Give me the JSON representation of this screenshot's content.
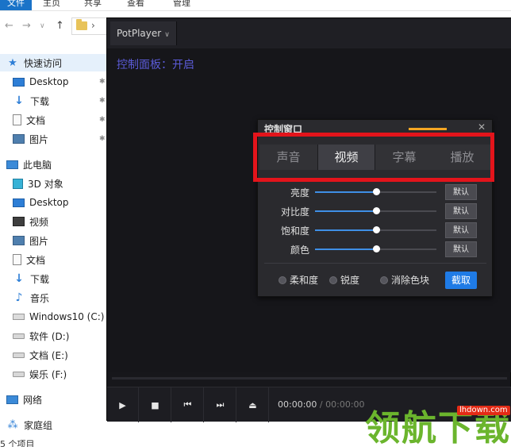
{
  "ribbon": {
    "file_tab": "文件",
    "tabs": [
      "主页",
      "共享",
      "查看",
      "管理"
    ]
  },
  "navpane": {
    "items": [
      {
        "label": "快速访问",
        "icon": "star-icon"
      },
      {
        "label": "Desktop",
        "icon": "desktop-icon"
      },
      {
        "label": "下载",
        "icon": "download-arrow-icon"
      },
      {
        "label": "文档",
        "icon": "document-icon"
      },
      {
        "label": "图片",
        "icon": "pictures-icon"
      },
      {
        "label": "此电脑",
        "icon": "computer-icon"
      },
      {
        "label": "3D 对象",
        "icon": "3d-objects-icon"
      },
      {
        "label": "Desktop",
        "icon": "desktop-icon"
      },
      {
        "label": "视频",
        "icon": "video-icon"
      },
      {
        "label": "图片",
        "icon": "pictures-icon"
      },
      {
        "label": "文档",
        "icon": "document-icon"
      },
      {
        "label": "下载",
        "icon": "download-arrow-icon"
      },
      {
        "label": "音乐",
        "icon": "music-icon"
      },
      {
        "label": "Windows10 (C:)",
        "icon": "system-drive-icon"
      },
      {
        "label": "软件 (D:)",
        "icon": "drive-icon"
      },
      {
        "label": "文档 (E:)",
        "icon": "drive-icon"
      },
      {
        "label": "娱乐 (F:)",
        "icon": "drive-icon"
      },
      {
        "label": "网络",
        "icon": "network-icon"
      },
      {
        "label": "家庭组",
        "icon": "homegroup-icon"
      }
    ],
    "status": "5 个项目"
  },
  "player": {
    "title": "PotPlayer",
    "osd_text": "控制面板：开启",
    "time_current": "00:00:00",
    "time_separator": "/",
    "time_total": "00:00:00"
  },
  "panel": {
    "title": "控制窗口",
    "tabs": [
      "声音",
      "视频",
      "字幕",
      "播放"
    ],
    "active_tab": "视频",
    "sliders": [
      {
        "label": "亮度",
        "value": 0.5,
        "button": "默认"
      },
      {
        "label": "对比度",
        "value": 0.5,
        "button": "默认"
      },
      {
        "label": "饱和度",
        "value": 0.5,
        "button": "默认"
      },
      {
        "label": "颜色",
        "value": 0.5,
        "button": "默认"
      }
    ],
    "options": [
      "柔和度",
      "锐度",
      "消除色块"
    ],
    "capture_button": "截取"
  },
  "watermark": {
    "site": "lhdown.com",
    "text": "领航下载"
  },
  "colors": {
    "highlight": "#e3141b",
    "accent": "#1f7be6",
    "osd": "#5b5bd8",
    "watermark": "#6bb52d"
  }
}
